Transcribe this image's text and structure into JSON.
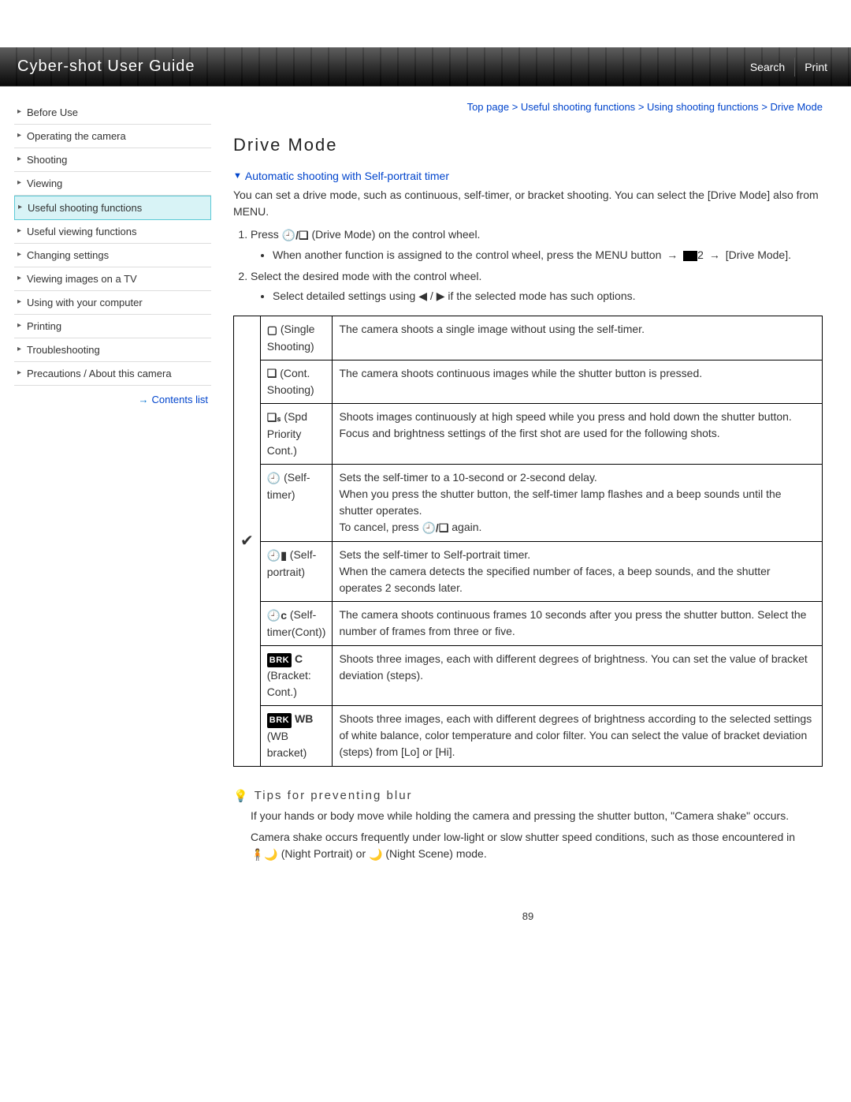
{
  "header": {
    "title": "Cyber-shot User Guide",
    "search": "Search",
    "print": "Print"
  },
  "breadcrumb": {
    "top": "Top page",
    "l1": "Useful shooting functions",
    "l2": "Using shooting functions",
    "l3": "Drive Mode"
  },
  "sidebar": {
    "items": [
      "Before Use",
      "Operating the camera",
      "Shooting",
      "Viewing",
      "Useful shooting functions",
      "Useful viewing functions",
      "Changing settings",
      "Viewing images on a TV",
      "Using with your computer",
      "Printing",
      "Troubleshooting",
      "Precautions / About this camera"
    ],
    "active_index": 4,
    "contents_list": "Contents list"
  },
  "main": {
    "title": "Drive Mode",
    "sublink": "Automatic shooting with Self-portrait timer",
    "intro": "You can set a drive mode, such as continuous, self-timer, or bracket shooting. You can select the [Drive Mode] also from MENU.",
    "step1_a": "Press ",
    "step1_b": " (Drive Mode) on the control wheel.",
    "step1_bullet_a": "When another function is assigned to the control wheel, press the MENU button ",
    "step1_bullet_b": "[Drive Mode].",
    "step2": "Select the desired mode with the control wheel.",
    "step2_bullet_a": "Select detailed settings using ",
    "step2_bullet_b": " if the selected mode has such options.",
    "rows": [
      {
        "mode": " (Single Shooting)",
        "desc": "The camera shoots a single image without using the self-timer."
      },
      {
        "mode": " (Cont. Shooting)",
        "desc": "The camera shoots continuous images while the shutter button is pressed."
      },
      {
        "mode": " (Spd Priority Cont.)",
        "desc": "Shoots images continuously at high speed while you press and hold down the shutter button. Focus and brightness settings of the first shot are used for the following shots."
      },
      {
        "mode": " (Self-timer)",
        "desc_a": "Sets the self-timer to a 10-second or 2-second delay.",
        "desc_b": "When you press the shutter button, the self-timer lamp flashes and a beep sounds until the shutter operates.",
        "desc_c": "To cancel, press ",
        "desc_d": " again."
      },
      {
        "mode": " (Self-portrait)",
        "desc_a": "Sets the self-timer to Self-portrait timer.",
        "desc_b": "When the camera detects the specified number of faces, a beep sounds, and the shutter operates 2 seconds later."
      },
      {
        "mode": " (Self-timer(Cont))",
        "desc": "The camera shoots continuous frames 10 seconds after you press the shutter button. Select the number of frames from three or five."
      },
      {
        "mode": " (Bracket: Cont.)",
        "desc": "Shoots three images, each with different degrees of brightness. You can set the value of bracket deviation (steps)."
      },
      {
        "mode": " (WB bracket)",
        "desc": "Shoots three images, each with different degrees of brightness according to the selected settings of white balance, color temperature and color filter. You can select the value of bracket deviation (steps) from [Lo] or [Hi]."
      }
    ],
    "tips": {
      "title": "Tips for preventing blur",
      "p1": "If your hands or body move while holding the camera and pressing the shutter button, \"Camera shake\" occurs.",
      "p2_a": "Camera shake occurs frequently under low-light or slow shutter speed conditions, such as those encountered in ",
      "p2_b": " (Night Portrait) or ",
      "p2_c": " (Night Scene) mode."
    }
  },
  "footer": {
    "page": "89"
  }
}
